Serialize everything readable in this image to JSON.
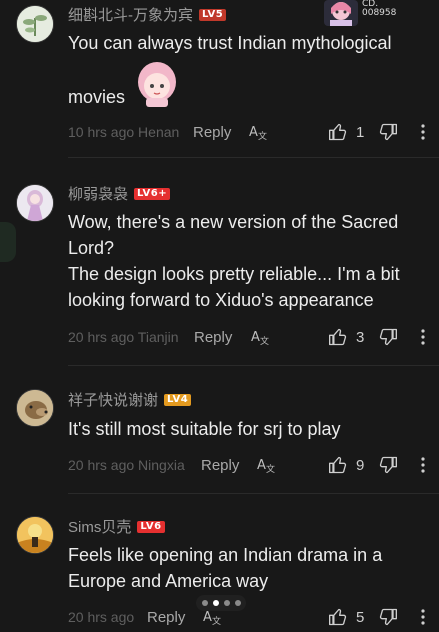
{
  "header_widget": {
    "label_top": "CD.",
    "label_bottom": "008958"
  },
  "comments": [
    {
      "username": "细斟北斗-万象为宾",
      "level": "LV5",
      "level_color": "#c33",
      "avatar_icon": "plant-avatar",
      "body": [
        "You can always trust Indian mythological",
        "movies"
      ],
      "sticker": "anime-girl-sticker",
      "timestamp": "10 hrs ago Henan",
      "reply": "Reply",
      "likes": "1"
    },
    {
      "username": "柳弱袅袅",
      "level": "LV6+",
      "level_color": "#e53030",
      "avatar_icon": "anime-avatar",
      "body": [
        "Wow, there's a new version of the Sacred",
        "Lord?",
        "The design looks pretty reliable... I'm a bit",
        "looking forward to Xiduo's appearance"
      ],
      "timestamp": "20 hrs ago Tianjin",
      "reply": "Reply",
      "likes": "3"
    },
    {
      "username": "祥子快说谢谢",
      "level": "LV4",
      "level_color": "#e39a20",
      "avatar_icon": "dog-avatar",
      "body": [
        "It's still most suitable for srj to play"
      ],
      "timestamp": "20 hrs ago Ningxia",
      "reply": "Reply",
      "likes": "9"
    },
    {
      "username": "Sims贝壳",
      "level": "LV6",
      "level_color": "#e53030",
      "avatar_icon": "sunset-avatar",
      "body": [
        "Feels like opening an Indian drama in a",
        "Europe and America way"
      ],
      "timestamp": "20 hrs ago",
      "reply": "Reply",
      "likes": "5"
    }
  ]
}
